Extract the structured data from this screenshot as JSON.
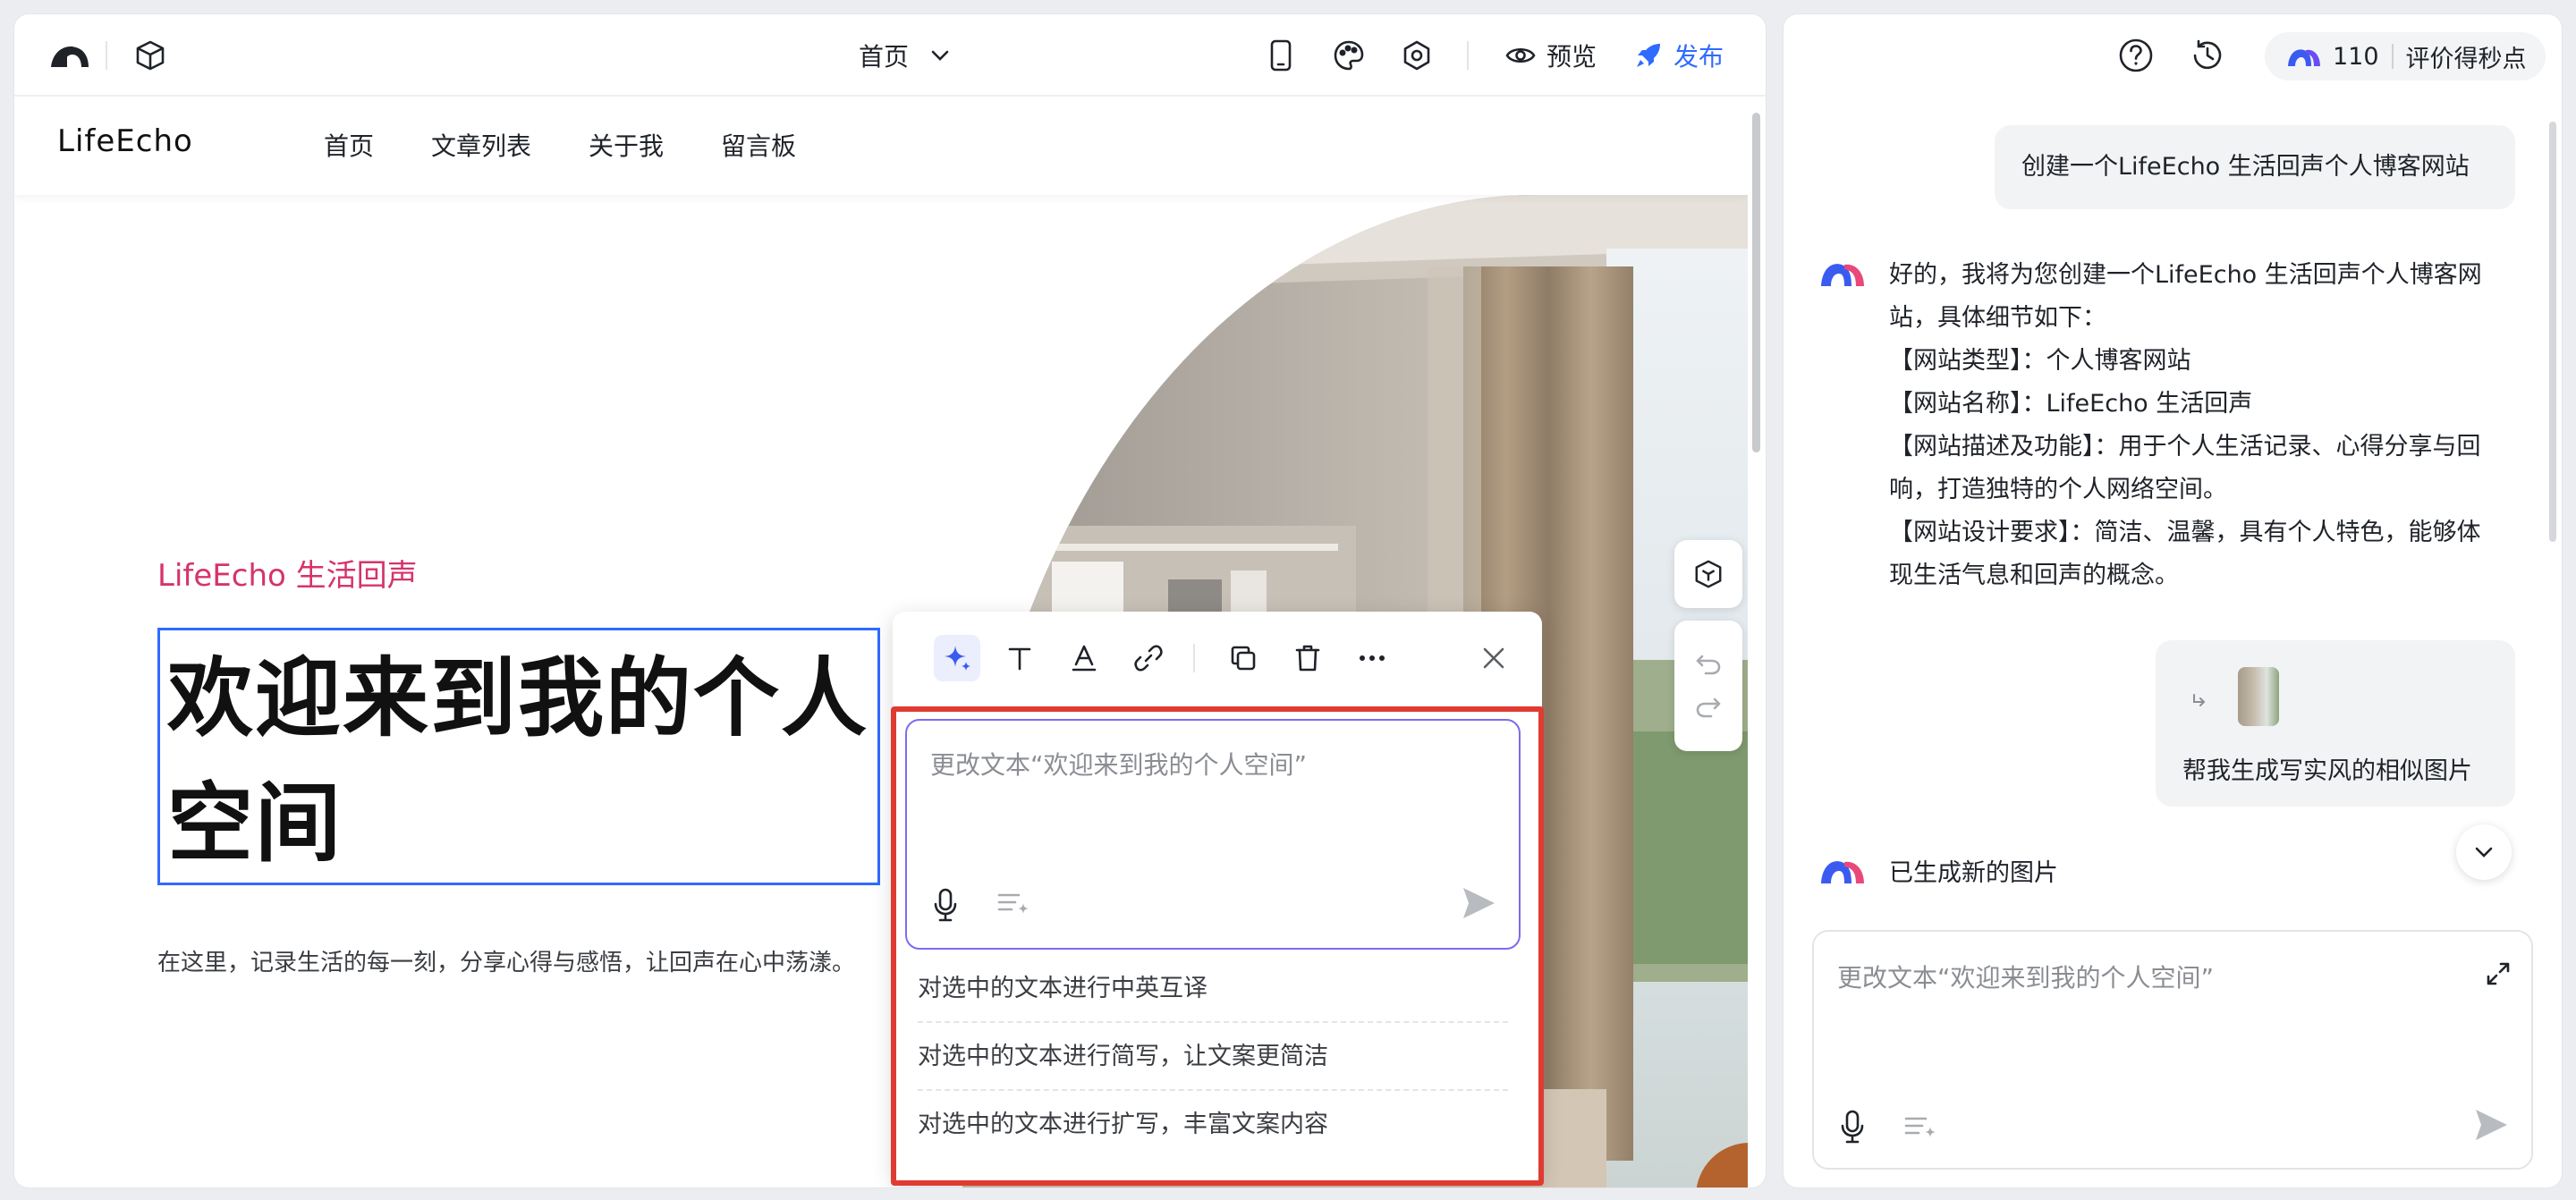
{
  "editor_toolbar": {
    "page_select": "首页",
    "preview_label": "预览",
    "publish_label": "发布"
  },
  "site": {
    "logo": "LifeEcho",
    "nav": [
      "首页",
      "文章列表",
      "关于我",
      "留言板"
    ],
    "hero_tag": "LifeEcho 生活回声",
    "hero_title_line1": "欢迎来到我的个人",
    "hero_title_line2": "空间",
    "hero_subtitle": "在这里，记录生活的每一刻，分享心得与感悟，让回声在心中荡漾。"
  },
  "ai_popup": {
    "input_placeholder": "更改文本“欢迎来到我的个人空间”",
    "suggestions": [
      "对选中的文本进行中英互译",
      "对选中的文本进行简写，让文案更简洁",
      "对选中的文本进行扩写，丰富文案内容"
    ]
  },
  "chat": {
    "credits_count": "110",
    "credits_label": "评价得秒点",
    "user_msg_1": "创建一个LifeEcho 生活回声个人博客网站",
    "ai_msg_lines": [
      "好的，我将为您创建一个LifeEcho 生活回声个人博客网",
      "站，具体细节如下：",
      "【网站类型】：个人博客网站",
      "【网站名称】：LifeEcho 生活回声",
      "【网站描述及功能】：用于个人生活记录、心得分享与回",
      "响，打造独特的个人网络空间。",
      "【网站设计要求】：简洁、温馨，具有个人特色，能够体",
      "现生活气息和回声的概念。"
    ],
    "user_msg_2": "帮我生成写实风的相似图片",
    "ai_msg_2": "已生成新的图片",
    "input_placeholder": "更改文本“欢迎来到我的个人空间”"
  },
  "colors": {
    "accent_blue": "#2f6bff",
    "publish_blue": "#2f6bff",
    "brand_pink": "#d6336c",
    "red_frame": "#df3b32",
    "input_purple": "#7a6cf0"
  }
}
